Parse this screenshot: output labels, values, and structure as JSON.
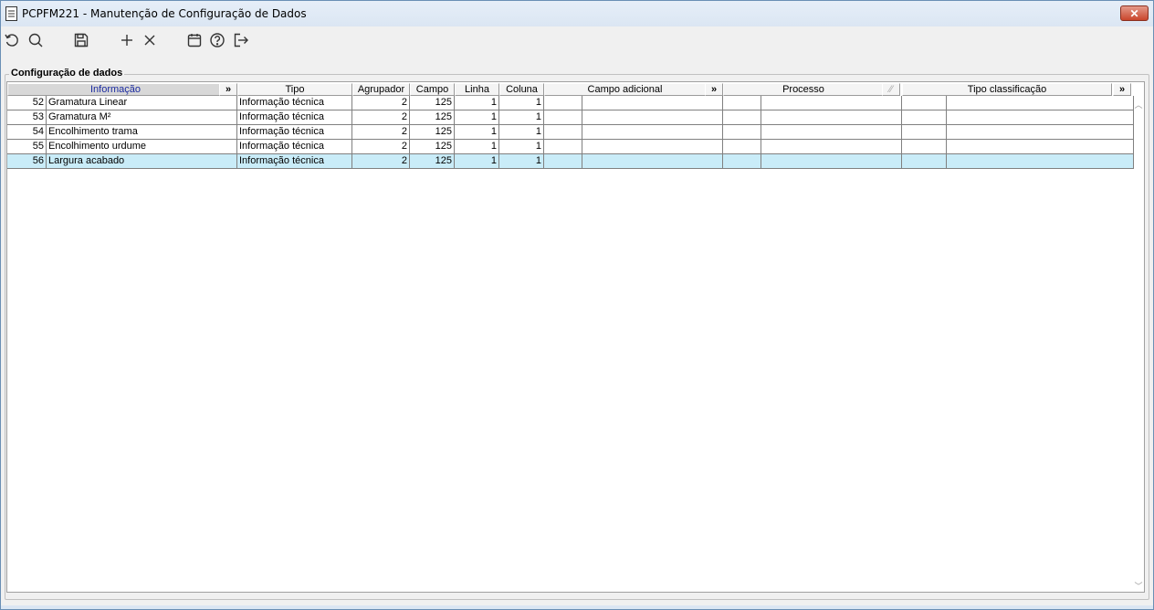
{
  "window": {
    "title": "PCPFM221 - Manutenção de Configuração de Dados",
    "close_label": "✕"
  },
  "toolbar": {
    "buttons": [
      "refresh-icon",
      "search-icon",
      "save-icon",
      "add-icon",
      "delete-icon",
      "calendar-icon",
      "help-icon",
      "exit-icon"
    ]
  },
  "group": {
    "label": "Configuração de dados"
  },
  "columns": {
    "informacao": "Informação",
    "tipo": "Tipo",
    "agrupador": "Agrupador",
    "campo": "Campo",
    "linha": "Linha",
    "coluna": "Coluna",
    "campo_adicional": "Campo adicional",
    "processo": "Processo",
    "tipo_classificacao": "Tipo classificação",
    "expand": "»"
  },
  "rows": [
    {
      "code": "52",
      "info": "Gramatura Linear",
      "tipo": "Informação técnica",
      "agrupador": "2",
      "campo": "125",
      "linha": "1",
      "coluna": "1"
    },
    {
      "code": "53",
      "info": "Gramatura M²",
      "tipo": "Informação técnica",
      "agrupador": "2",
      "campo": "125",
      "linha": "1",
      "coluna": "1"
    },
    {
      "code": "54",
      "info": "Encolhimento trama",
      "tipo": "Informação técnica",
      "agrupador": "2",
      "campo": "125",
      "linha": "1",
      "coluna": "1"
    },
    {
      "code": "55",
      "info": "Encolhimento urdume",
      "tipo": "Informação técnica",
      "agrupador": "2",
      "campo": "125",
      "linha": "1",
      "coluna": "1"
    },
    {
      "code": "56",
      "info": "Largura acabado",
      "tipo": "Informação técnica",
      "agrupador": "2",
      "campo": "125",
      "linha": "1",
      "coluna": "1"
    }
  ],
  "selected_row": 4,
  "colors": {
    "selected": "#c9ecf8",
    "sorted_header_text": "#1a2aa0"
  }
}
